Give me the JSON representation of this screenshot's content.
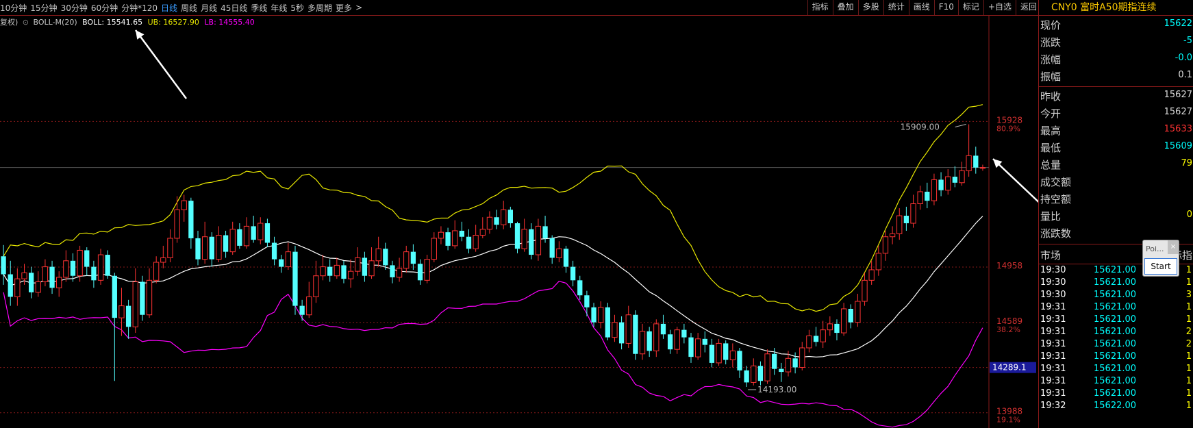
{
  "toolbar": {
    "periods": [
      "10分钟",
      "15分钟",
      "30分钟",
      "60分钟",
      "分钟*120",
      "日线",
      "周线",
      "月线",
      "45日线",
      "季线",
      "年线",
      "5秒",
      "多周期",
      "更多"
    ],
    "active_period": "日线",
    "more_arrow": ">",
    "tools": [
      "指标",
      "叠加",
      "多股",
      "统计",
      "画线",
      "F10",
      "标记",
      "+自选",
      "返回"
    ]
  },
  "indicator": {
    "fq_label": "复权)",
    "name": "BOLL-M(20)",
    "boll_label": "BOLL: 15541.65",
    "ub_label": "UB: 16527.90",
    "lb_label": "LB: 14555.40",
    "colors": {
      "boll": "#ffffff",
      "ub": "#e8e800",
      "lb": "#ff00ff"
    }
  },
  "price_axis": {
    "labels": [
      {
        "price": "15928",
        "pct": "80.9%"
      },
      {
        "price": "14958",
        "pct": ""
      },
      {
        "price": "14589",
        "pct": "38.2%"
      },
      {
        "price": "14289.1",
        "pct": ""
      },
      {
        "price": "13988",
        "pct": "19.1%"
      }
    ],
    "current_box": "14289.1"
  },
  "chart_annotations": {
    "high": "15909.00",
    "low": "14193.00"
  },
  "chart_data": {
    "type": "candlestick",
    "ylim": [
      13900,
      16600
    ],
    "upColor": "#ff3333",
    "downColor": "#54ffff",
    "candles": [
      [
        15030,
        14910,
        15105,
        14840
      ],
      [
        14910,
        14760,
        15000,
        14700
      ],
      [
        14760,
        14880,
        14950,
        14700
      ],
      [
        14880,
        14920,
        14980,
        14840
      ],
      [
        14920,
        14790,
        14960,
        14750
      ],
      [
        14790,
        14860,
        14930,
        14760
      ],
      [
        14860,
        14960,
        15010,
        14830
      ],
      [
        14960,
        14820,
        15000,
        14780
      ],
      [
        14820,
        14890,
        14930,
        14760
      ],
      [
        14890,
        15000,
        15070,
        14860
      ],
      [
        15000,
        14900,
        15050,
        14860
      ],
      [
        14900,
        15070,
        15100,
        14860
      ],
      [
        15070,
        14960,
        15090,
        14900
      ],
      [
        14960,
        14870,
        15000,
        14820
      ],
      [
        14870,
        15040,
        15080,
        14840
      ],
      [
        15040,
        14900,
        15070,
        14880
      ],
      [
        14900,
        14620,
        14920,
        14200
      ],
      [
        14620,
        14700,
        14820,
        14500
      ],
      [
        14700,
        14560,
        14740,
        14480
      ],
      [
        14560,
        14860,
        14950,
        14520
      ],
      [
        14860,
        14640,
        14900,
        14600
      ],
      [
        14640,
        14870,
        14950,
        14620
      ],
      [
        14870,
        14990,
        15030,
        14850
      ],
      [
        14990,
        15020,
        15100,
        14950
      ],
      [
        15020,
        15150,
        15210,
        14990
      ],
      [
        15150,
        15340,
        15430,
        15120
      ],
      [
        15340,
        15400,
        15440,
        15260
      ],
      [
        15400,
        15150,
        15420,
        15080
      ],
      [
        15150,
        15010,
        15200,
        14970
      ],
      [
        15010,
        15160,
        15260,
        14980
      ],
      [
        15160,
        15010,
        15190,
        14960
      ],
      [
        15010,
        15170,
        15230,
        14990
      ],
      [
        15170,
        15060,
        15200,
        15020
      ],
      [
        15060,
        15210,
        15260,
        15040
      ],
      [
        15210,
        15100,
        15250,
        15080
      ],
      [
        15100,
        15230,
        15290,
        15080
      ],
      [
        15230,
        15140,
        15300,
        15120
      ],
      [
        15140,
        15250,
        15290,
        15110
      ],
      [
        15250,
        15120,
        15280,
        15090
      ],
      [
        15120,
        15010,
        15160,
        14970
      ],
      [
        15010,
        14960,
        15040,
        14920
      ],
      [
        14960,
        15060,
        15120,
        14940
      ],
      [
        15060,
        14700,
        15100,
        14640
      ],
      [
        14700,
        14640,
        14740,
        14600
      ],
      [
        14640,
        14760,
        14860,
        14620
      ],
      [
        14760,
        14900,
        15000,
        14720
      ],
      [
        14900,
        14960,
        15040,
        14870
      ],
      [
        14960,
        14900,
        15010,
        14860
      ],
      [
        14900,
        14970,
        15020,
        14880
      ],
      [
        14970,
        14880,
        15000,
        14850
      ],
      [
        14880,
        14930,
        15010,
        14820
      ],
      [
        14930,
        15020,
        15090,
        14900
      ],
      [
        15020,
        14900,
        15060,
        14860
      ],
      [
        14900,
        15000,
        15090,
        14880
      ],
      [
        15000,
        15080,
        15160,
        14960
      ],
      [
        15080,
        14970,
        15120,
        14940
      ],
      [
        14970,
        14890,
        15000,
        14850
      ],
      [
        14890,
        14950,
        15020,
        14860
      ],
      [
        14950,
        15060,
        15100,
        14920
      ],
      [
        15060,
        14980,
        15110,
        14940
      ],
      [
        14980,
        14870,
        15010,
        14840
      ],
      [
        14870,
        15010,
        15040,
        14850
      ],
      [
        15010,
        15150,
        15190,
        14990
      ],
      [
        15150,
        15190,
        15230,
        15110
      ],
      [
        15190,
        15100,
        15220,
        15070
      ],
      [
        15100,
        15200,
        15270,
        15080
      ],
      [
        15200,
        15160,
        15260,
        15130
      ],
      [
        15160,
        15080,
        15210,
        15050
      ],
      [
        15080,
        15170,
        15240,
        15060
      ],
      [
        15170,
        15210,
        15290,
        15150
      ],
      [
        15210,
        15290,
        15330,
        15180
      ],
      [
        15290,
        15240,
        15340,
        15210
      ],
      [
        15240,
        15340,
        15400,
        15210
      ],
      [
        15340,
        15250,
        15360,
        15220
      ],
      [
        15250,
        15080,
        15260,
        15050
      ],
      [
        15080,
        15210,
        15280,
        15060
      ],
      [
        15210,
        15040,
        15250,
        15010
      ],
      [
        15040,
        15230,
        15280,
        15000
      ],
      [
        15230,
        15150,
        15300,
        15120
      ],
      [
        15150,
        15020,
        15170,
        14980
      ],
      [
        15020,
        15080,
        15130,
        14990
      ],
      [
        15080,
        14960,
        15100,
        14920
      ],
      [
        14960,
        14870,
        15000,
        14830
      ],
      [
        14870,
        14770,
        14900,
        14740
      ],
      [
        14770,
        14690,
        14800,
        14630
      ],
      [
        14690,
        14590,
        14720,
        14560
      ],
      [
        14590,
        14690,
        14730,
        14550
      ],
      [
        14690,
        14490,
        14720,
        14470
      ],
      [
        14490,
        14590,
        14640,
        14460
      ],
      [
        14590,
        14450,
        14630,
        14410
      ],
      [
        14450,
        14640,
        14700,
        14420
      ],
      [
        14640,
        14380,
        14670,
        14340
      ],
      [
        14380,
        14530,
        14580,
        14340
      ],
      [
        14530,
        14400,
        14560,
        14360
      ],
      [
        14400,
        14580,
        14610,
        14360
      ],
      [
        14580,
        14510,
        14640,
        14480
      ],
      [
        14510,
        14410,
        14540,
        14380
      ],
      [
        14410,
        14540,
        14560,
        14380
      ],
      [
        14540,
        14490,
        14580,
        14450
      ],
      [
        14490,
        14360,
        14520,
        14320
      ],
      [
        14360,
        14480,
        14520,
        14340
      ],
      [
        14480,
        14440,
        14530,
        14390
      ],
      [
        14440,
        14320,
        14480,
        14290
      ],
      [
        14320,
        14450,
        14480,
        14300
      ],
      [
        14450,
        14340,
        14470,
        14310
      ],
      [
        14340,
        14400,
        14450,
        14290
      ],
      [
        14400,
        14270,
        14420,
        14220
      ],
      [
        14270,
        14190,
        14300,
        14160
      ],
      [
        14190,
        14300,
        14350,
        14170
      ],
      [
        14300,
        14200,
        14330,
        14170
      ],
      [
        14200,
        14380,
        14410,
        14180
      ],
      [
        14380,
        14280,
        14420,
        14240
      ],
      [
        14280,
        14260,
        14320,
        14193
      ],
      [
        14260,
        14350,
        14400,
        14230
      ],
      [
        14350,
        14290,
        14390,
        14250
      ],
      [
        14290,
        14420,
        14460,
        14270
      ],
      [
        14420,
        14500,
        14540,
        14390
      ],
      [
        14500,
        14460,
        14560,
        14430
      ],
      [
        14460,
        14540,
        14600,
        14420
      ],
      [
        14540,
        14580,
        14630,
        14500
      ],
      [
        14580,
        14520,
        14610,
        14470
      ],
      [
        14520,
        14680,
        14720,
        14500
      ],
      [
        14680,
        14590,
        14710,
        14550
      ],
      [
        14590,
        14730,
        14780,
        14560
      ],
      [
        14730,
        14870,
        14920,
        14700
      ],
      [
        14870,
        14940,
        15000,
        14840
      ],
      [
        14940,
        15050,
        15100,
        14900
      ],
      [
        15050,
        15160,
        15200,
        15000
      ],
      [
        15160,
        15180,
        15230,
        15110
      ],
      [
        15180,
        15300,
        15350,
        15140
      ],
      [
        15300,
        15250,
        15360,
        15200
      ],
      [
        15250,
        15380,
        15440,
        15220
      ],
      [
        15380,
        15460,
        15500,
        15340
      ],
      [
        15460,
        15400,
        15520,
        15350
      ],
      [
        15400,
        15540,
        15580,
        15370
      ],
      [
        15540,
        15470,
        15590,
        15430
      ],
      [
        15470,
        15560,
        15610,
        15440
      ],
      [
        15560,
        15520,
        15630,
        15490
      ],
      [
        15520,
        15600,
        15660,
        15500
      ],
      [
        15600,
        15700,
        15909,
        15560
      ],
      [
        15700,
        15621,
        15760,
        15580
      ],
      [
        15621,
        15621,
        15640,
        15600
      ]
    ],
    "boll": [],
    "ub": [],
    "lb": []
  },
  "side": {
    "title": "CNY0 富时A50期指连续",
    "quote_group1": [
      {
        "label": "现价",
        "value": "15622",
        "color": "#00ffff"
      },
      {
        "label": "涨跌",
        "value": "-5",
        "color": "#00ffff"
      },
      {
        "label": "涨幅",
        "value": "-0.0",
        "color": "#00ffff"
      },
      {
        "label": "振幅",
        "value": "0.1",
        "color": "#dddddd"
      }
    ],
    "quote_group2": [
      {
        "label": "昨收",
        "value": "15627",
        "color": "#dddddd"
      },
      {
        "label": "今开",
        "value": "15627",
        "color": "#dddddd"
      },
      {
        "label": "最高",
        "value": "15633",
        "color": "#ff3333"
      },
      {
        "label": "最低",
        "value": "15609",
        "color": "#00ffff"
      },
      {
        "label": "总量",
        "value": "79",
        "color": "#ffff00"
      },
      {
        "label": "成交额",
        "value": "",
        "color": "#dddddd"
      },
      {
        "label": "持空额",
        "value": "",
        "color": "#dddddd"
      },
      {
        "label": "量比",
        "value": "0",
        "color": "#ffff00"
      },
      {
        "label": "涨跌数",
        "value": "",
        "color": "#dddddd"
      }
    ],
    "market_label": "市场",
    "market_right": "标指",
    "ticks": [
      {
        "time": "19:30",
        "price": "15621.00",
        "vol": "1"
      },
      {
        "time": "19:30",
        "price": "15621.00",
        "vol": "1"
      },
      {
        "time": "19:30",
        "price": "15621.00",
        "vol": "3"
      },
      {
        "time": "19:31",
        "price": "15621.00",
        "vol": "1"
      },
      {
        "time": "19:31",
        "price": "15621.00",
        "vol": "1"
      },
      {
        "time": "19:31",
        "price": "15621.00",
        "vol": "2"
      },
      {
        "time": "19:31",
        "price": "15621.00",
        "vol": "2"
      },
      {
        "time": "19:31",
        "price": "15621.00",
        "vol": "1"
      },
      {
        "time": "19:31",
        "price": "15621.00",
        "vol": "1"
      },
      {
        "time": "19:31",
        "price": "15621.00",
        "vol": "1"
      },
      {
        "time": "19:31",
        "price": "15621.00",
        "vol": "1"
      },
      {
        "time": "19:32",
        "price": "15622.00",
        "vol": "1"
      }
    ]
  },
  "popup": {
    "label": "Poi...",
    "close": "×",
    "button": "Start"
  }
}
